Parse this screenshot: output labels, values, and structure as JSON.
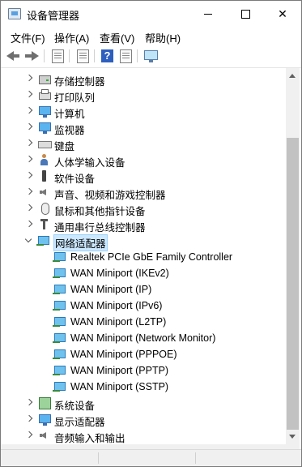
{
  "window": {
    "title": "设备管理器",
    "controls": {
      "minimize": "minimize",
      "maximize": "maximize",
      "close": "✕"
    }
  },
  "menu": [
    "文件(F)",
    "操作(A)",
    "查看(V)",
    "帮助(H)"
  ],
  "toolbar": {
    "icons": [
      "back-icon",
      "forward-icon",
      "properties-icon",
      "update-icon",
      "help-icon",
      "view-icon",
      "monitor-icon"
    ],
    "help_glyph": "?"
  },
  "tree": {
    "categories": [
      {
        "label": "存储控制器",
        "icon": "storage-controller-icon",
        "expanded": false
      },
      {
        "label": "打印队列",
        "icon": "printer-icon",
        "expanded": false
      },
      {
        "label": "计算机",
        "icon": "computer-icon",
        "expanded": false
      },
      {
        "label": "监视器",
        "icon": "monitor-icon",
        "expanded": false
      },
      {
        "label": "键盘",
        "icon": "keyboard-icon",
        "expanded": false
      },
      {
        "label": "人体学输入设备",
        "icon": "human-interface-icon",
        "expanded": false
      },
      {
        "label": "软件设备",
        "icon": "software-device-icon",
        "expanded": false
      },
      {
        "label": "声音、视频和游戏控制器",
        "icon": "speaker-icon",
        "expanded": false
      },
      {
        "label": "鼠标和其他指针设备",
        "icon": "mouse-icon",
        "expanded": false
      },
      {
        "label": "通用串行总线控制器",
        "icon": "usb-icon",
        "expanded": false
      },
      {
        "label": "网络适配器",
        "icon": "network-adapter-icon",
        "expanded": true,
        "selected": true
      }
    ],
    "network_adapters": [
      "Realtek PCIe GbE Family Controller",
      "WAN Miniport (IKEv2)",
      "WAN Miniport (IP)",
      "WAN Miniport (IPv6)",
      "WAN Miniport (L2TP)",
      "WAN Miniport (Network Monitor)",
      "WAN Miniport (PPPOE)",
      "WAN Miniport (PPTP)",
      "WAN Miniport (SSTP)"
    ],
    "after": [
      {
        "label": "系统设备",
        "icon": "system-device-icon",
        "expanded": false
      },
      {
        "label": "显示适配器",
        "icon": "display-adapter-icon",
        "expanded": false
      },
      {
        "label": "音频输入和输出",
        "icon": "audio-io-icon",
        "expanded": false
      }
    ]
  },
  "colors": {
    "selection_bg": "#cce8ff",
    "selection_border": "#99d1ff",
    "chrome": "#f0f0f0"
  }
}
